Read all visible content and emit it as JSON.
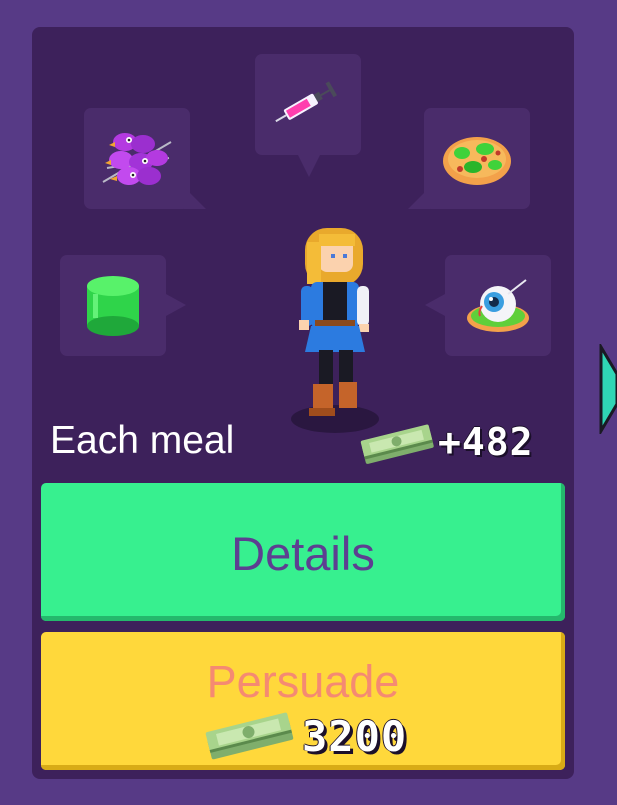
{
  "meal_label": "Each meal",
  "income_per_meal": "+482",
  "buttons": {
    "details_label": "Details",
    "persuade_label": "Persuade",
    "persuade_cost": "3200"
  },
  "icons": {
    "food_1": "purple-bird-skewers-icon",
    "food_2": "syringe-icon",
    "food_3": "green-slime-pizza-icon",
    "food_4": "green-jelly-icon",
    "food_5": "eyeball-dish-icon",
    "money": "money-stack-icon",
    "next": "next-arrow-icon"
  },
  "colors": {
    "background": "#573a86",
    "panel": "#3d215b",
    "details_button": "#37f08f",
    "details_text": "#5d3f91",
    "persuade_button": "#ffd83b",
    "persuade_text": "#f58a72",
    "next_arrow": "#2fd6b5"
  }
}
